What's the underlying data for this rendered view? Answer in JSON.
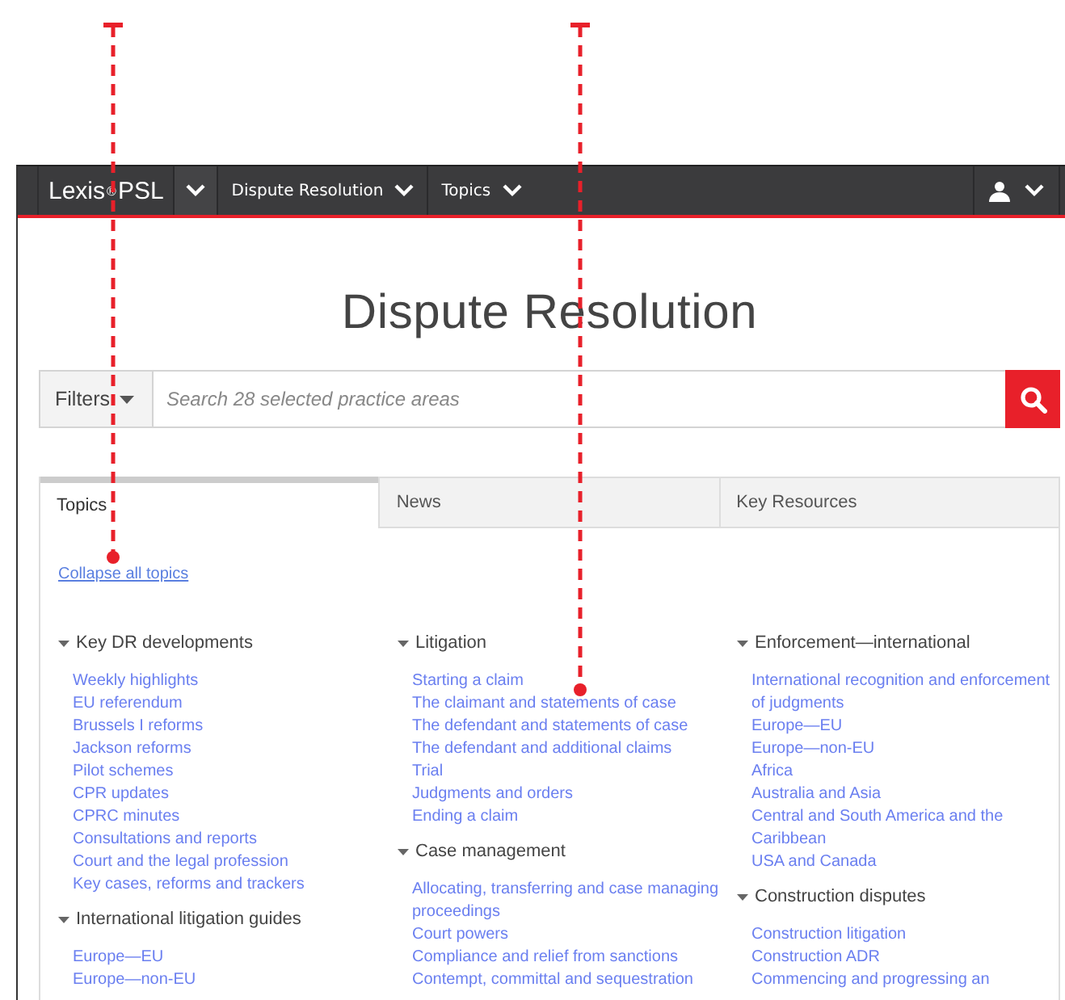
{
  "nav": {
    "brand": "Lexis$^{®}$PSL",
    "menus": [
      {
        "label": "Dispute Resolution"
      },
      {
        "label": "Topics"
      }
    ]
  },
  "title": "Dispute Resolution",
  "search": {
    "filters_label": "Filters",
    "placeholder": "Search 28 selected practice areas"
  },
  "tabs": [
    {
      "label": "Topics",
      "selected": true
    },
    {
      "label": "News",
      "selected": false
    },
    {
      "label": "Key Resources",
      "selected": false
    }
  ],
  "collapse_link": "Collapse all topics",
  "columns": [
    [
      {
        "heading": "Key DR developments",
        "expanded": true,
        "items": [
          "Weekly highlights",
          "EU referendum",
          "Brussels I reforms",
          "Jackson reforms",
          "Pilot schemes",
          "CPR updates",
          "CPRC minutes",
          "Consultations and reports",
          "Court and the legal profession",
          "Key cases, reforms and trackers"
        ]
      },
      {
        "heading": "International litigation guides",
        "expanded": true,
        "items": [
          "Europe—EU",
          "Europe—non-EU"
        ]
      }
    ],
    [
      {
        "heading": "Litigation",
        "expanded": true,
        "items": [
          "Starting a claim",
          "The claimant and statements of case",
          "The defendant and statements of case",
          "The defendant and additional claims",
          "Trial",
          "Judgments and orders",
          "Ending a claim"
        ]
      },
      {
        "heading": "Case management",
        "expanded": true,
        "items": [
          "Allocating, transferring and case managing proceedings",
          "Court powers",
          "Compliance and relief from sanctions",
          "Contempt, committal and sequestration"
        ]
      }
    ],
    [
      {
        "heading": "Enforcement—international",
        "expanded": true,
        "items": [
          "International recognition and enforcement of judgments",
          "Europe—EU",
          "Europe—non-EU",
          "Africa",
          "Australia and Asia",
          "Central and South America and the Caribbean",
          "USA and Canada"
        ]
      },
      {
        "heading": "Construction disputes",
        "expanded": true,
        "items": [
          "Construction litigation",
          "Construction ADR",
          "Commencing and progressing an"
        ]
      }
    ]
  ]
}
